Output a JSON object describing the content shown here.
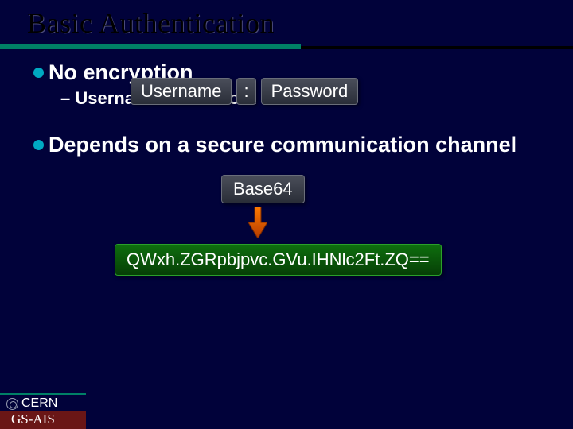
{
  "title": "Basic Authentication",
  "bullets": {
    "b1": "No encryption",
    "b1_sub": "– Username / Password 'encoded'",
    "b2": "Depends on a secure communication channel"
  },
  "pills": {
    "username": "Username",
    "colon": ":",
    "password": "Password"
  },
  "base64_label": "Base64",
  "encoded_string": "QWxh.ZGRpbjpvc.GVu.IHNlc2Ft.ZQ==",
  "footer": {
    "org": "CERN",
    "dept": "GS-AIS"
  },
  "colors": {
    "bg": "#01023a",
    "accent_green": "#008066",
    "bullet_cyan": "#00a9c2",
    "enc_green": "#0e6e0e",
    "footer_red": "#6a1616"
  }
}
